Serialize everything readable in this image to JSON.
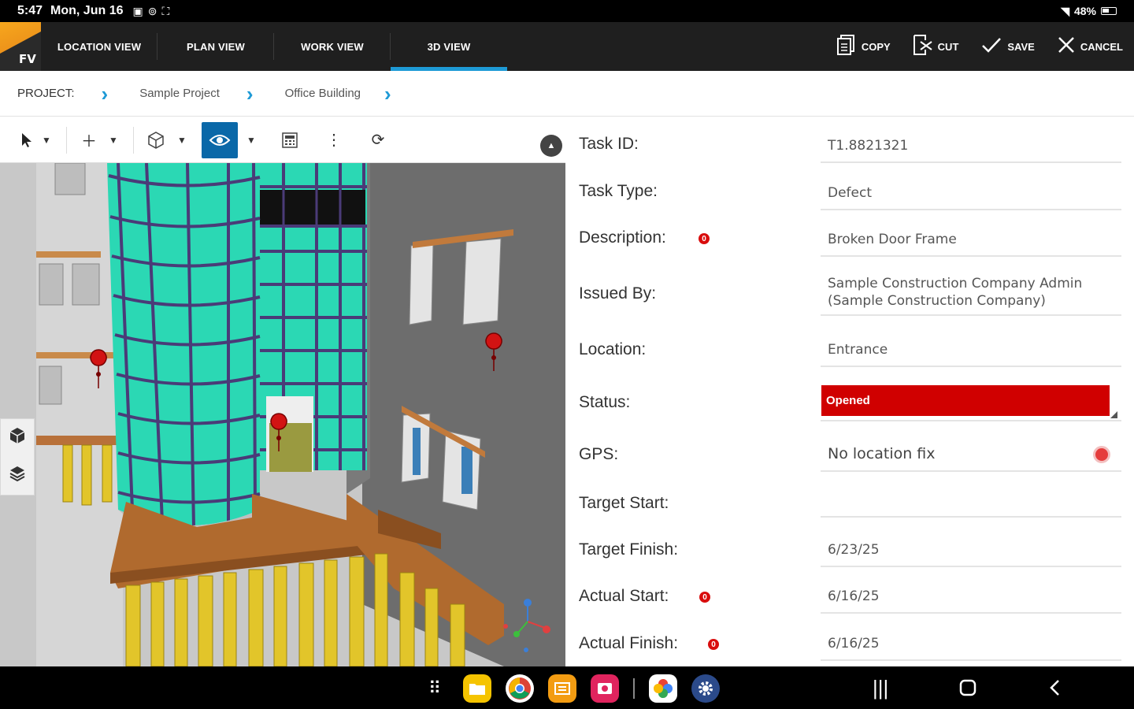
{
  "status_bar": {
    "time": "5:47",
    "date": "Mon, Jun 16",
    "battery": "48%"
  },
  "app": {
    "logo_text": "FV",
    "tabs": [
      {
        "label": "LOCATION VIEW"
      },
      {
        "label": "PLAN VIEW"
      },
      {
        "label": "WORK VIEW"
      },
      {
        "label": "3D VIEW",
        "active": true
      }
    ],
    "actions": {
      "copy": "COPY",
      "cut": "CUT",
      "save": "SAVE",
      "cancel": "CANCEL"
    }
  },
  "breadcrumb": {
    "label": "PROJECT:",
    "items": [
      "Sample Project",
      "Office Building"
    ]
  },
  "form": {
    "task_id": {
      "label": "Task ID:",
      "value": "T1.8821321"
    },
    "task_type": {
      "label": "Task Type:",
      "value": "Defect"
    },
    "description": {
      "label": "Description:",
      "value": "Broken Door Frame",
      "required": "0"
    },
    "issued_by": {
      "label": "Issued By:",
      "line1": "Sample Construction Company Admin",
      "line2": "(Sample Construction Company)"
    },
    "location": {
      "label": "Location:",
      "value": "Entrance"
    },
    "status": {
      "label": "Status:",
      "value": "Opened",
      "color": "#d00000"
    },
    "gps": {
      "label": "GPS:",
      "value": "No location fix"
    },
    "target_start": {
      "label": "Target Start:",
      "value": ""
    },
    "target_finish": {
      "label": "Target Finish:",
      "value": "6/23/25"
    },
    "actual_start": {
      "label": "Actual Start:",
      "value": "6/16/25",
      "required": "0"
    },
    "actual_finish": {
      "label": "Actual Finish:",
      "value": "6/16/25",
      "required": "0"
    }
  },
  "colors": {
    "accent": "#1e9ad6",
    "appbar": "#1f1f1f",
    "tool_active": "#0a68a8",
    "glass": "#2bd8b4"
  },
  "icons": {
    "toolbar": [
      "select-arrow-icon",
      "add-icon",
      "cube-icon",
      "eye-icon",
      "calculator-icon",
      "more-vert-icon",
      "refresh-icon"
    ],
    "side": [
      "cube-3d-icon",
      "layers-icon"
    ]
  }
}
